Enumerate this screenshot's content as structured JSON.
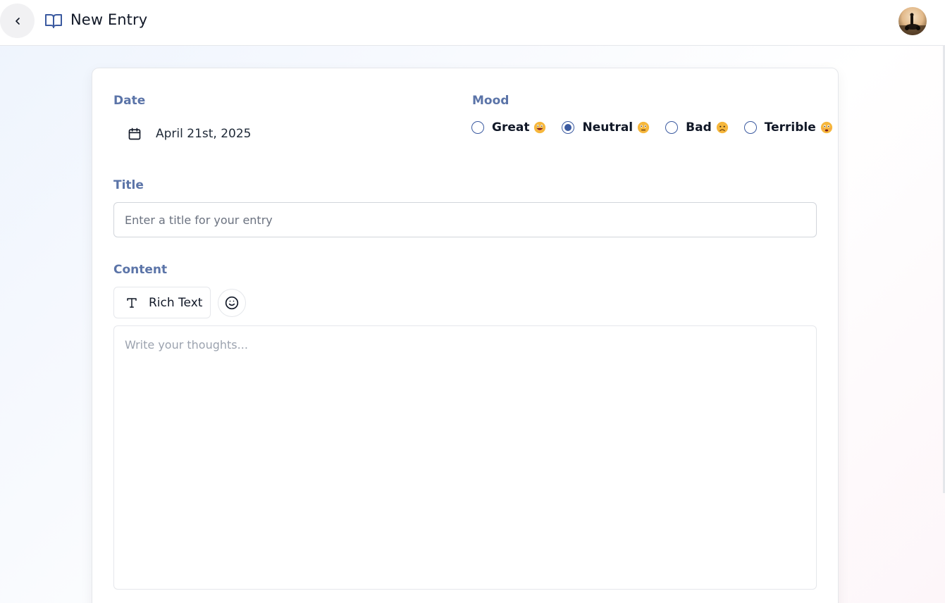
{
  "header": {
    "title": "New Entry",
    "back_icon": "chevron-left-icon",
    "title_icon": "book-open-icon",
    "accent_color": "#3b5aa0"
  },
  "form": {
    "date": {
      "label": "Date",
      "value": "April 21st, 2025",
      "icon": "calendar-icon"
    },
    "mood": {
      "label": "Mood",
      "selected": "Neutral",
      "options": [
        {
          "label": "Great",
          "emoji_icon": "grinning-face-icon"
        },
        {
          "label": "Neutral",
          "emoji_icon": "neutral-face-icon"
        },
        {
          "label": "Bad",
          "emoji_icon": "sad-face-icon"
        },
        {
          "label": "Terrible",
          "emoji_icon": "distressed-face-icon"
        }
      ]
    },
    "title": {
      "label": "Title",
      "value": "",
      "placeholder": "Enter a title for your entry"
    },
    "content": {
      "label": "Content",
      "rich_text_label": "Rich Text",
      "rich_text_icon": "type-icon",
      "emoji_button_icon": "smile-icon",
      "value": "",
      "placeholder": "Write your thoughts..."
    }
  },
  "colors": {
    "label": "#5b74a8",
    "radio": "#3b5aa0",
    "emoji": "#f6b73c"
  }
}
